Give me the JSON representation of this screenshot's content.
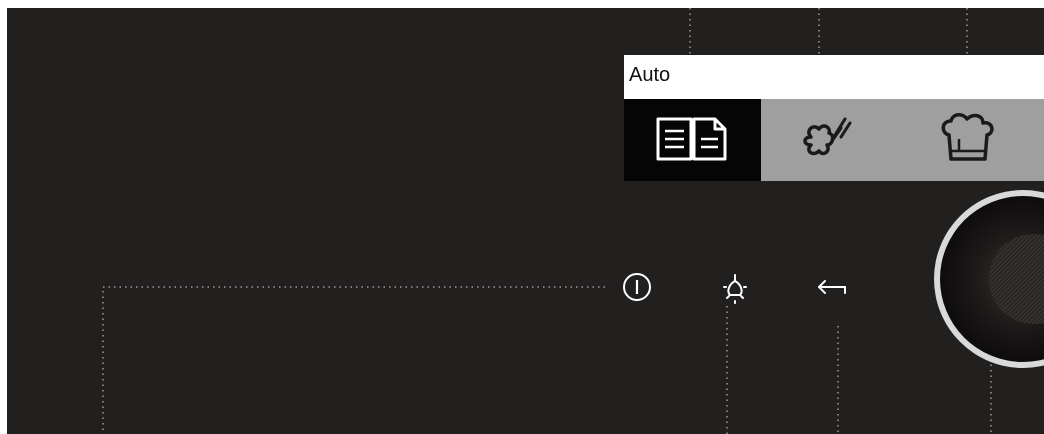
{
  "display": {
    "title": "Auto",
    "tabs": [
      {
        "icon": "recipe-book-icon",
        "selected": true
      },
      {
        "icon": "steam-clean-icon",
        "selected": false
      },
      {
        "icon": "chef-hat-icon",
        "selected": false
      }
    ]
  },
  "controls": [
    {
      "name": "power-button",
      "icon": "power-icon"
    },
    {
      "name": "light-button",
      "icon": "lightbulb-icon"
    },
    {
      "name": "back-button",
      "icon": "back-arrow-icon"
    }
  ],
  "knob": {
    "name": "control-knob"
  },
  "colors": {
    "panel": "#221f1f",
    "display_header": "#ffffff",
    "tab_selected": "#050505",
    "tab_inactive": "#9f9f9f",
    "icon_light": "#ffffff",
    "icon_dark": "#111111",
    "dotted_line": "#9a9a9a",
    "knob_ring": "#d9d9d9"
  }
}
